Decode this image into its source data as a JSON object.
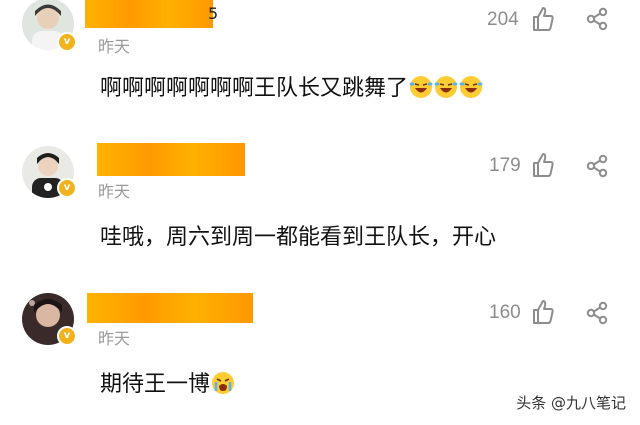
{
  "comments": [
    {
      "name_tail": "5",
      "time": "昨天",
      "likes": "204",
      "text": "啊啊啊啊啊啊啊王队长又跳舞了",
      "emoji_count": 3
    },
    {
      "time": "昨天",
      "likes": "179",
      "text": "哇哦，周六到周一都能看到王队长，开心"
    },
    {
      "time": "昨天",
      "likes": "160",
      "text": "期待王一博"
    }
  ],
  "watermark": "头条 @九八笔记",
  "colors": {
    "name_redaction": "#ffa500",
    "verified_badge": "#f2b21b",
    "muted": "#9a9a9a"
  },
  "icons": [
    "thumbs-up-icon",
    "share-icon",
    "verified-badge-icon",
    "laughing-tears-emoji",
    "crying-emoji"
  ]
}
